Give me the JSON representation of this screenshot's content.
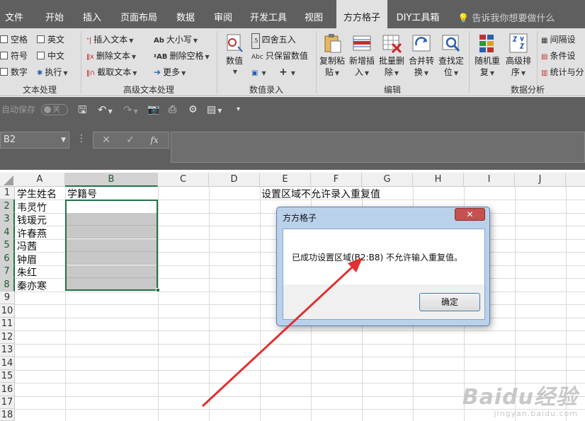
{
  "tabs": [
    {
      "label": "文件"
    },
    {
      "label": "开始"
    },
    {
      "label": "插入"
    },
    {
      "label": "页面布局"
    },
    {
      "label": "数据"
    },
    {
      "label": "审阅"
    },
    {
      "label": "开发工具"
    },
    {
      "label": "视图"
    },
    {
      "label": "方方格子"
    },
    {
      "label": "DIY工具箱"
    }
  ],
  "tell_me": "告诉我你想要做什么",
  "ribbon": {
    "text_processing": {
      "items": [
        "空格",
        "英文",
        "符号",
        "中文",
        "数字",
        "执行"
      ],
      "label": "文本处理"
    },
    "advanced_text": {
      "items": [
        "插入文本",
        "删除文本",
        "截取文本",
        "大小写",
        "删除空格",
        "更多"
      ],
      "label": "高级文本处理"
    },
    "data_entry": {
      "big": "数值",
      "items": [
        "四舍五入",
        "只保留数值"
      ],
      "label": "数值录入"
    },
    "edit": {
      "buttons": [
        {
          "line1": "复制粘",
          "line2": "贴"
        },
        {
          "line1": "新增插",
          "line2": "入"
        },
        {
          "line1": "批量删",
          "line2": "除"
        },
        {
          "line1": "合并转",
          "line2": "换"
        },
        {
          "line1": "查找定",
          "line2": "位"
        }
      ],
      "label": "编辑"
    },
    "analysis": {
      "buttons": [
        {
          "line1": "随机重",
          "line2": "复"
        },
        {
          "line1": "高级排",
          "line2": "序"
        }
      ],
      "items": [
        "间隔设",
        "条件设",
        "统计与分"
      ],
      "label": "数据分析"
    }
  },
  "qat": {
    "autosave": "自动保存",
    "toggle": "关"
  },
  "formula_bar": {
    "name_box": "B2",
    "cancel": "✕",
    "enter": "✓",
    "fx": "fx"
  },
  "columns": [
    "A",
    "B",
    "C",
    "D",
    "E",
    "F",
    "G",
    "H",
    "I",
    "J"
  ],
  "rows": [
    "1",
    "2",
    "3",
    "4",
    "5",
    "6",
    "7",
    "8",
    "9",
    "10",
    "11",
    "12",
    "13",
    "14",
    "15",
    "16",
    "17",
    "18"
  ],
  "cells": {
    "A1": "学生姓名",
    "B1": "学籍号",
    "E1": "设置区域不允许录入重复值",
    "A2": "韦灵竹",
    "A3": "钱瑗元",
    "A4": "许春燕",
    "A5": "冯茜",
    "A6": "钟眉",
    "A7": "朱红",
    "A8": "秦亦寒"
  },
  "dialog": {
    "title": "方方格子",
    "close": "✕",
    "message": "已成功设置区域(B2:B8) 不允许输入重复值。",
    "ok": "确定"
  },
  "watermark": {
    "main": "Baidu经验",
    "sub": "jingyan.baidu.com"
  },
  "colors": {
    "accent": "#217346",
    "arrow": "#e03030",
    "dark_chrome": "#5f5f5f"
  }
}
